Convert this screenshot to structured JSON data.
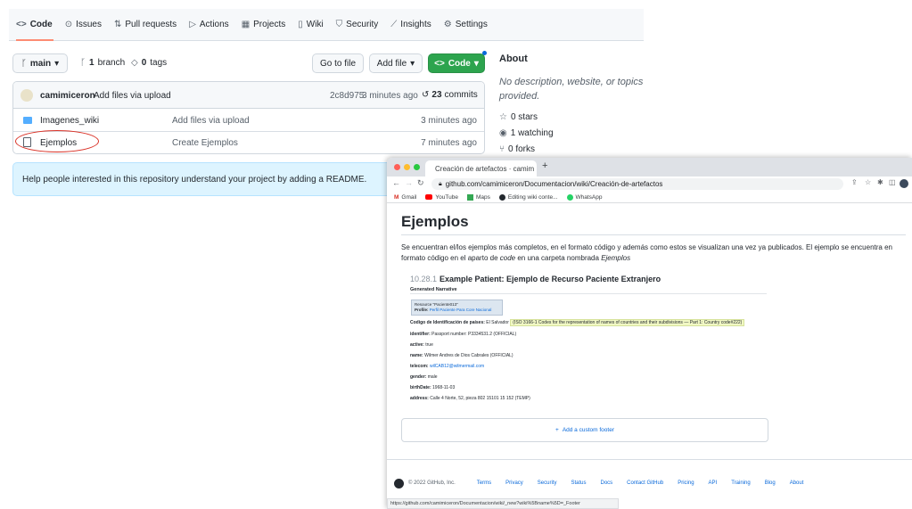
{
  "repo": {
    "nav": [
      {
        "icon": "<>",
        "label": "Code"
      },
      {
        "icon": "⊙",
        "label": "Issues"
      },
      {
        "icon": "⇅",
        "label": "Pull requests"
      },
      {
        "icon": "▷",
        "label": "Actions"
      },
      {
        "icon": "▦",
        "label": "Projects"
      },
      {
        "icon": "▯",
        "label": "Wiki"
      },
      {
        "icon": "⛉",
        "label": "Security"
      },
      {
        "icon": "⟋",
        "label": "Insights"
      },
      {
        "icon": "⚙",
        "label": "Settings"
      }
    ],
    "branch_button": "main",
    "branches_count": "1",
    "branches_label": "branch",
    "tags_count": "0",
    "tags_label": "tags",
    "go_to_file": "Go to file",
    "add_file": "Add file",
    "code_button": "Code",
    "commit": {
      "author": "camimiceron",
      "message": "Add files via upload",
      "hash": "2c8d975",
      "time": "3 minutes ago",
      "commits_count": "23",
      "commits_label": "commits"
    },
    "files": [
      {
        "name": "Imagenes_wiki",
        "message": "Add files via upload",
        "time": "3 minutes ago"
      },
      {
        "name": "Ejemplos",
        "message": "Create Ejemplos",
        "time": "7 minutes ago"
      }
    ],
    "readme_banner": "Help people interested in this repository understand your project by adding a README.",
    "about": {
      "title": "About",
      "description": "No description, website, or topics provided.",
      "stars": "0 stars",
      "watching": "1 watching",
      "forks": "0 forks"
    }
  },
  "browser": {
    "tab_title": "Creación de artefactos · camim",
    "url": "github.com/camimiceron/Documentacion/wiki/Creación-de-artefactos",
    "bookmarks": [
      "Gmail",
      "YouTube",
      "Maps",
      "Editing wiki conte...",
      "WhatsApp"
    ],
    "wiki": {
      "title": "Ejemplos",
      "para_1": "Se encuentran el/los ejemplos más completos, en el formato código y además como estos se visualizan una vez ya publicados. El ejemplo se encuentra en formato código en el aparto de ",
      "para_code": "code",
      "para_2": " en una carpeta nombrada ",
      "para_folder": "Ejemplos",
      "example_number": "10.28.1",
      "example_title": "Example Patient: Ejemplo de Recurso Paciente Extranjero",
      "generated": "Generated Narrative",
      "resource_line": "Resource \"Paciente013\"",
      "profile_label": "Profile:",
      "profile_value": "Perfil Paciente Para Core Nacional",
      "fields": [
        {
          "label": "Codigo de Identificación de países:",
          "value": "El Salvador",
          "extra": "(ISO 3166-1 Codes for the representation of names of countries and their subdivisions — Part 1: Country code#222)"
        },
        {
          "label": "identifier:",
          "value": "Passport number: P3334531.2 (OFFICIAL)"
        },
        {
          "label": "active:",
          "value": "true"
        },
        {
          "label": "name:",
          "value": "Wilmer Andres de Dios Cabrales (OFFICIAL)"
        },
        {
          "label": "telecom:",
          "value": "wilCAB12@wilmermail.com"
        },
        {
          "label": "gender:",
          "value": "male"
        },
        {
          "label": "birthDate:",
          "value": "1968-11-03"
        },
        {
          "label": "address:",
          "value": "Calle 4 Norte, 52, pieza 802 15101 15 152 (TEMP)"
        }
      ],
      "add_footer": "Add a custom footer"
    },
    "footer": {
      "copyright": "© 2022 GitHub, Inc.",
      "links": [
        "Terms",
        "Privacy",
        "Security",
        "Status",
        "Docs",
        "Contact GitHub",
        "Pricing",
        "API",
        "Training",
        "Blog",
        "About"
      ]
    },
    "status_url": "https://github.com/camimiceron/Documentacion/wiki/_new?wiki%5Bname%5D=_Footer"
  },
  "colors": {
    "accent_green": "#2da44e",
    "link_blue": "#0969da",
    "annotation_red": "#d93025"
  }
}
